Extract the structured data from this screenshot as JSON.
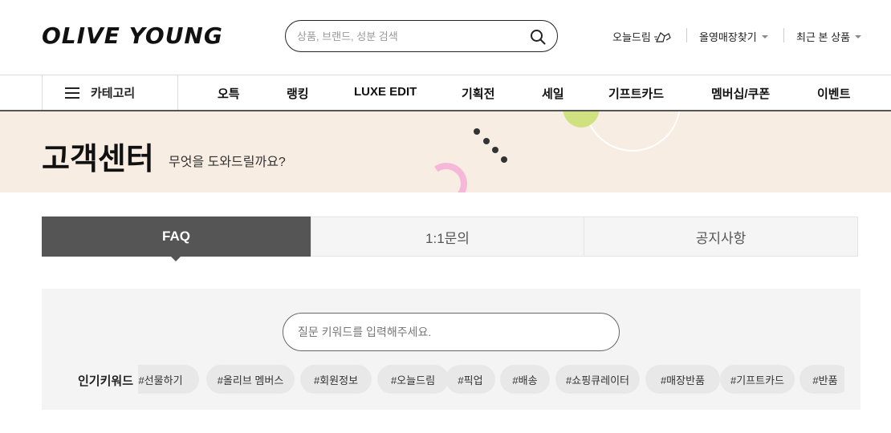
{
  "header": {
    "logo": "OLIVE YOUNG",
    "search_placeholder": "상품, 브랜드, 성분 검색",
    "util": {
      "today_dream": "오늘드림",
      "store_finder": "올영매장찾기",
      "recent": "최근 본 상품"
    }
  },
  "nav": {
    "category_label": "카테고리",
    "items": [
      "오특",
      "랭킹",
      "LUXE EDIT",
      "기획전",
      "세일",
      "기프트카드",
      "멤버십/쿠폰",
      "이벤트"
    ]
  },
  "banner": {
    "title": "고객센터",
    "subtitle": "무엇을 도와드릴까요?"
  },
  "tabs": [
    {
      "label": "FAQ",
      "active": true
    },
    {
      "label": "1:1문의",
      "active": false
    },
    {
      "label": "공지사항",
      "active": false
    }
  ],
  "faq": {
    "search_placeholder": "질문 키워드를 입력해주세요.",
    "keywords_label": "인기키워드",
    "keywords": [
      "#선물하기",
      "#올리브 멤버스",
      "#회원정보",
      "#오늘드림",
      "#픽업",
      "#배송",
      "#쇼핑큐레이터",
      "#매장반품",
      "#기프트카드",
      "#반품"
    ]
  },
  "colors": {
    "banner_bg": "#f8ede2",
    "tab_active": "#555555",
    "accent_green": "#cfe27f",
    "accent_pink": "#f5b8d8"
  }
}
